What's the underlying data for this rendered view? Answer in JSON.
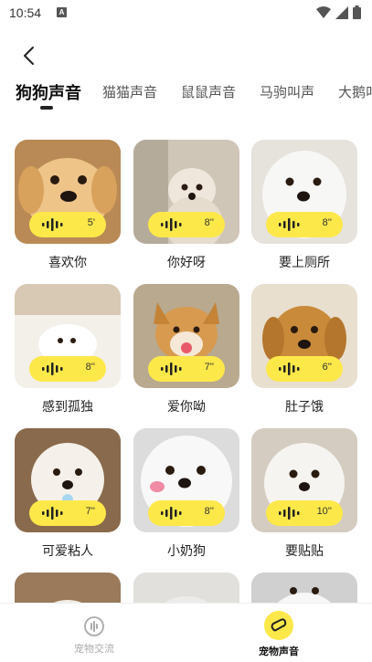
{
  "status_bar": {
    "time": "10:54",
    "notification_badge": "A"
  },
  "tabs": [
    {
      "label": "狗狗声音",
      "active": true
    },
    {
      "label": "猫猫声音",
      "active": false
    },
    {
      "label": "鼠鼠声音",
      "active": false
    },
    {
      "label": "马驹叫声",
      "active": false
    },
    {
      "label": "大鹅叫",
      "active": false
    }
  ],
  "sounds": [
    {
      "label": "喜欢你",
      "duration": "5'",
      "color": "#e8b56a"
    },
    {
      "label": "你好呀",
      "duration": "8''",
      "color": "#d8c8b0"
    },
    {
      "label": "要上厕所",
      "duration": "8''",
      "color": "#f1f1f1"
    },
    {
      "label": "感到孤独",
      "duration": "8''",
      "color": "#f4f2ee"
    },
    {
      "label": "爱你呦",
      "duration": "7''",
      "color": "#d69a52"
    },
    {
      "label": "肚子饿",
      "duration": "6''",
      "color": "#c98a3a"
    },
    {
      "label": "可爱粘人",
      "duration": "7''",
      "color": "#f3efe8"
    },
    {
      "label": "小奶狗",
      "duration": "8''",
      "color": "#efefef"
    },
    {
      "label": "要贴贴",
      "duration": "10''",
      "color": "#ececec"
    }
  ],
  "bottom_nav": [
    {
      "label": "宠物交流",
      "icon": "chat-icon",
      "active": false
    },
    {
      "label": "宠物声音",
      "icon": "sound-icon",
      "active": true
    }
  ],
  "colors": {
    "accent": "#fde84a",
    "text": "#222222",
    "inactive": "#aaaaaa"
  }
}
